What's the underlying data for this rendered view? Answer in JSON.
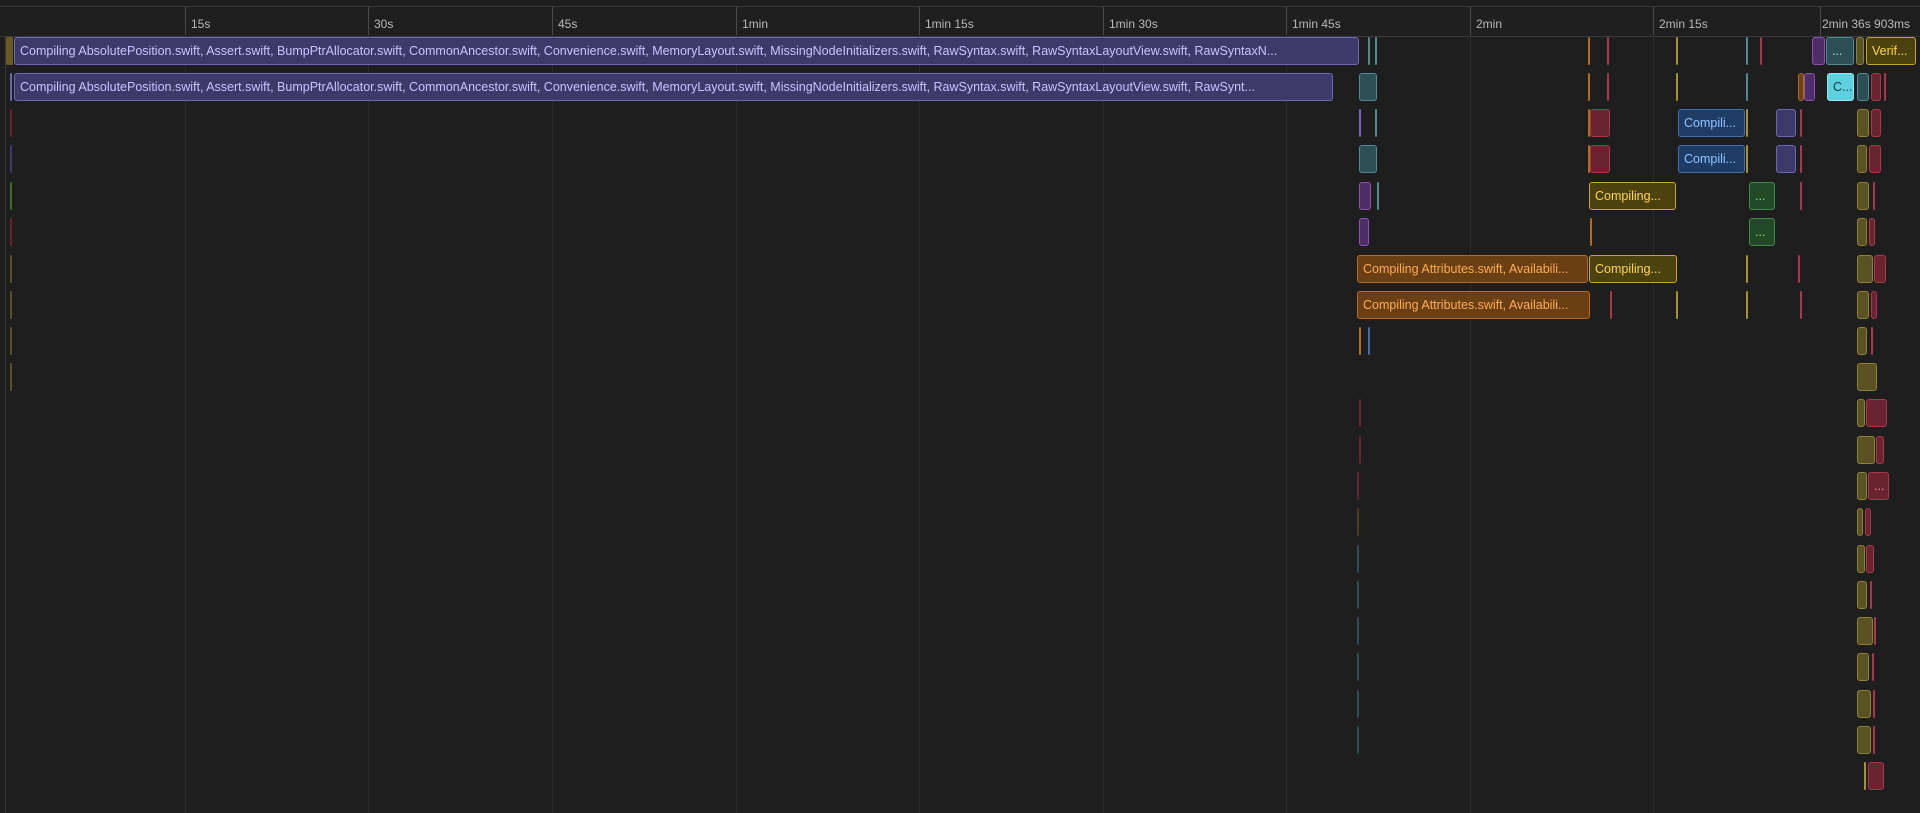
{
  "ruler": {
    "ticks": [
      "15s",
      "30s",
      "45s",
      "1min",
      "1min 15s",
      "1min 30s",
      "1min 45s",
      "2min",
      "2min 15s"
    ],
    "end_label": "2min 36s 903ms"
  },
  "tasks": {
    "row0_main": "Compiling AbsolutePosition.swift, Assert.swift, BumpPtrAllocator.swift, CommonAncestor.swift, Convenience.swift, MemoryLayout.swift, MissingNodeInitializers.swift, RawSyntax.swift, RawSyntaxLayoutView.swift, RawSyntaxN...",
    "row0_teal": "...",
    "row0_verify": "Verif...",
    "row1_main": "Compiling AbsolutePosition.swift, Assert.swift, BumpPtrAllocator.swift, CommonAncestor.swift, Convenience.swift, MemoryLayout.swift, MissingNodeInitializers.swift, RawSyntax.swift, RawSyntaxLayoutView.swift, RawSynt...",
    "row1_cyan": "C...",
    "row2_blue": "Compili...",
    "row3_blue": "Compili...",
    "row4_yellow": "Compiling...",
    "row4_green": "...",
    "row5_green": "...",
    "row6_orange": "Compiling Attributes.swift, Availabili...",
    "row6_yellow": "Compiling...",
    "row7_orange": "Compiling Attributes.swift, Availabili...",
    "row12_red": "..."
  },
  "colors": {
    "background": "#1e1e1e",
    "purple": "#3d3a6a",
    "orange": "#b36a22",
    "yellow": "#a8922a",
    "blue": "#3f6fae",
    "green": "#3f8a47",
    "red": "#a8394c",
    "teal": "#4e8a94",
    "cyan": "#5fd0e0"
  }
}
